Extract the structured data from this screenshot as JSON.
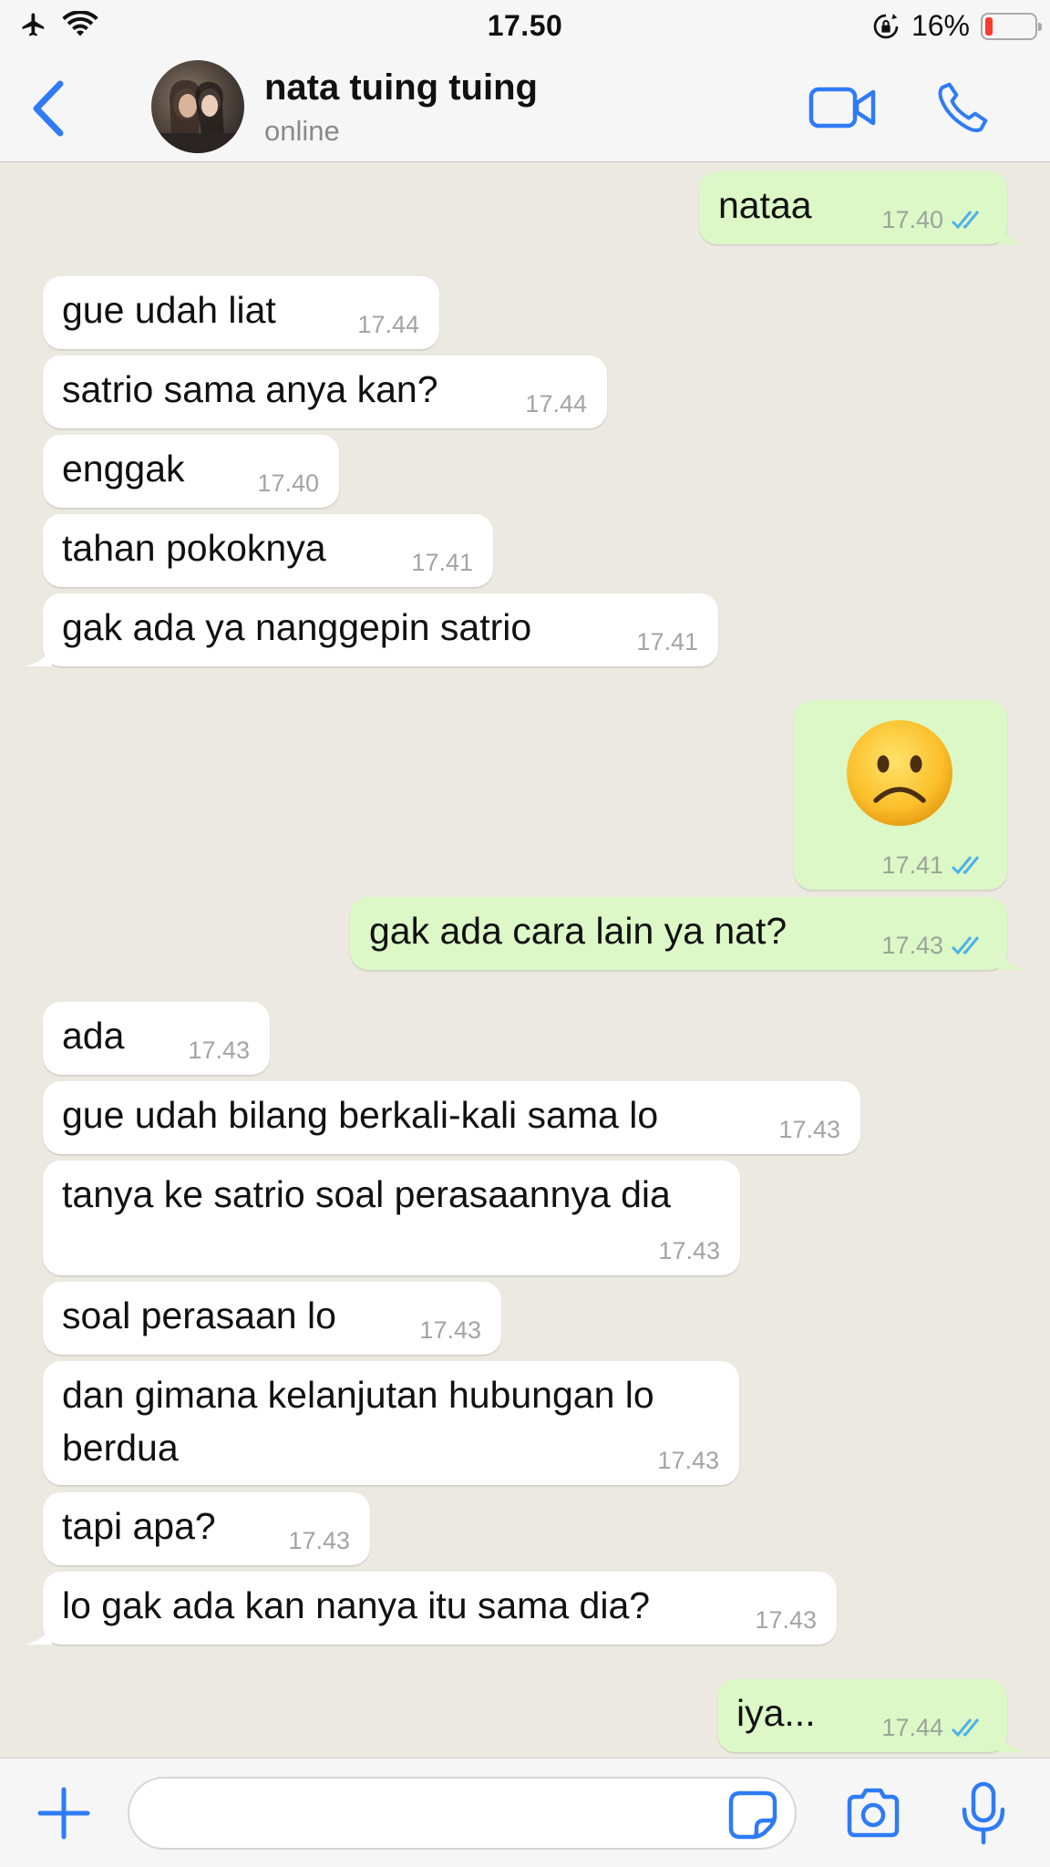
{
  "status_bar": {
    "time": "17.50",
    "battery_percent": "16%",
    "battery_level": 0.16,
    "icons": [
      "airplane-icon",
      "wifi-icon",
      "orientation-lock-icon",
      "battery-icon"
    ]
  },
  "header": {
    "contact_name": "nata tuing tuing",
    "status": "online",
    "icons": [
      "back-chevron-icon",
      "video-camera-icon",
      "phone-icon"
    ]
  },
  "messages": [
    {
      "dir": "out",
      "text": "nataa",
      "time": "17.40",
      "ticks": "read"
    },
    {
      "dir": "in",
      "text": "gue udah liat",
      "time": "17.44"
    },
    {
      "dir": "in",
      "text": "satrio sama anya kan?",
      "time": "17.44"
    },
    {
      "dir": "in",
      "text": "enggak",
      "time": "17.40"
    },
    {
      "dir": "in",
      "text": "tahan pokoknya",
      "time": "17.41"
    },
    {
      "dir": "in",
      "text": "gak ada ya nanggepin satrio",
      "time": "17.41"
    },
    {
      "dir": "out",
      "text": "",
      "emoji": "frowning-face-emoji",
      "time": "17.41",
      "ticks": "read"
    },
    {
      "dir": "out",
      "text": "gak ada cara lain ya nat?",
      "time": "17.43",
      "ticks": "read"
    },
    {
      "dir": "in",
      "text": "ada",
      "time": "17.43"
    },
    {
      "dir": "in",
      "text": "gue udah bilang berkali-kali sama lo",
      "time": "17.43"
    },
    {
      "dir": "in",
      "text": "tanya ke satrio soal perasaannya dia",
      "time": "17.43"
    },
    {
      "dir": "in",
      "text": "soal perasaan lo",
      "time": "17.43"
    },
    {
      "dir": "in",
      "text": "dan gimana kelanjutan hubungan lo",
      "text2": "berdua",
      "time": "17.43"
    },
    {
      "dir": "in",
      "text": "tapi apa?",
      "time": "17.43"
    },
    {
      "dir": "in",
      "text": "lo gak ada kan nanya itu sama dia?",
      "time": "17.43"
    },
    {
      "dir": "out",
      "text": "iya...",
      "time": "17.44",
      "ticks": "read"
    }
  ],
  "input_bar": {
    "placeholder": "",
    "icons": [
      "plus-icon",
      "sticker-icon",
      "camera-icon",
      "microphone-icon"
    ]
  },
  "colors": {
    "chat_background": "#ece9e2",
    "outgoing_bubble": "#dcf8c6",
    "incoming_bubble": "#ffffff",
    "accent": "#2f7bf6",
    "read_ticks": "#4fb1e8"
  }
}
